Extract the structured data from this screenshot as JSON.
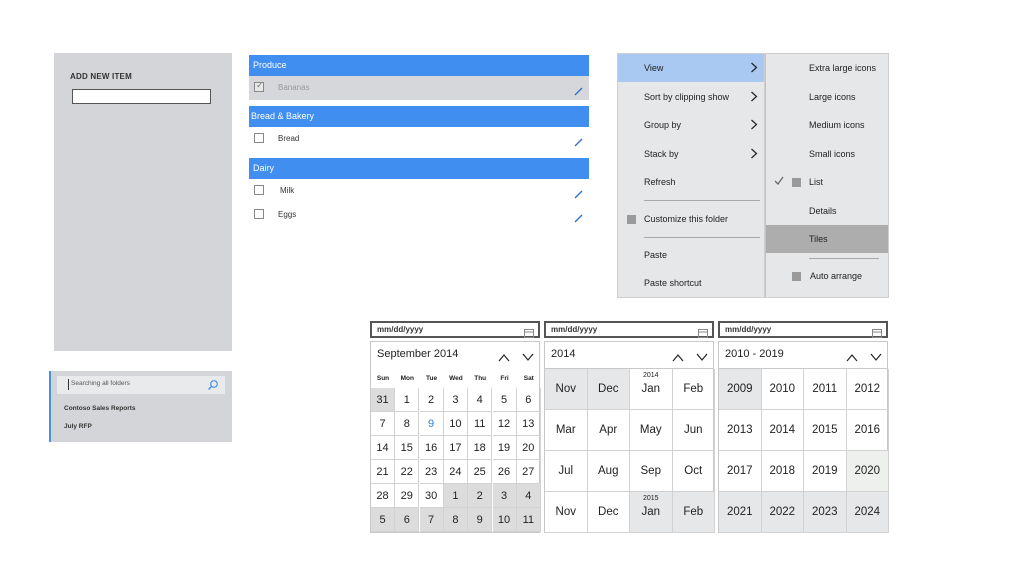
{
  "add_item": {
    "title": "ADD NEW ITEM",
    "input_value": ""
  },
  "search": {
    "placeholder": "Searching all folders",
    "results": [
      "Contoso Sales Reports",
      "July RFP"
    ]
  },
  "grocery": {
    "groups": [
      {
        "name": "Produce",
        "items": [
          {
            "label": "Bananas",
            "checked": true,
            "selected": true
          }
        ]
      },
      {
        "name": "Bread & Bakery",
        "items": [
          {
            "label": "Bread",
            "checked": false,
            "selected": false
          }
        ]
      },
      {
        "name": "Dairy",
        "items": [
          {
            "label": "Milk",
            "checked": false,
            "selected": false
          },
          {
            "label": "Eggs",
            "checked": false,
            "selected": false
          }
        ]
      }
    ]
  },
  "context_menu": {
    "main": [
      {
        "label": "View",
        "submenu": true,
        "highlighted": true
      },
      {
        "label": "Sort by clipping show",
        "submenu": true
      },
      {
        "label": "Group by",
        "submenu": true
      },
      {
        "label": "Stack by",
        "submenu": true
      },
      {
        "label": "Refresh",
        "submenu": false
      },
      {
        "label": "Customize this folder",
        "submenu": false
      },
      {
        "label": "Paste",
        "submenu": false
      },
      {
        "label": "Paste shortcut",
        "submenu": false
      }
    ],
    "sub": [
      {
        "label": "Extra large icons"
      },
      {
        "label": "Large icons"
      },
      {
        "label": "Medium icons"
      },
      {
        "label": "Small icons"
      },
      {
        "label": "List",
        "checked": true
      },
      {
        "label": "Details"
      },
      {
        "label": "Tiles",
        "selected": true
      },
      {
        "label": "Auto arrange"
      }
    ]
  },
  "date_placeholder": "mm/dd/yyyy",
  "calendar_month": {
    "header": "September 2014",
    "dow": [
      "Sun",
      "Mon",
      "Tue",
      "Wed",
      "Thu",
      "Fri",
      "Sat"
    ],
    "days": [
      [
        "31",
        1,
        2,
        3,
        4,
        5,
        6
      ],
      [
        7,
        8,
        9,
        10,
        11,
        12,
        13
      ],
      [
        14,
        15,
        16,
        17,
        18,
        19,
        20
      ],
      [
        21,
        22,
        23,
        24,
        25,
        26,
        27
      ],
      [
        28,
        29,
        30,
        1,
        2,
        3,
        4
      ],
      [
        5,
        6,
        7,
        8,
        9,
        10,
        11
      ]
    ],
    "today": 9
  },
  "calendar_year": {
    "header": "2014",
    "months": [
      {
        "v": "Nov",
        "out": true
      },
      {
        "v": "Dec",
        "out": true
      },
      {
        "v": "Jan",
        "sup": "2014"
      },
      {
        "v": "Feb"
      },
      {
        "v": "Mar"
      },
      {
        "v": "Apr"
      },
      {
        "v": "May"
      },
      {
        "v": "Jun"
      },
      {
        "v": "Jul"
      },
      {
        "v": "Aug"
      },
      {
        "v": "Sep"
      },
      {
        "v": "Oct"
      },
      {
        "v": "Nov"
      },
      {
        "v": "Dec"
      },
      {
        "v": "Jan",
        "sup": "2015",
        "out": true
      },
      {
        "v": "Feb",
        "out": true
      }
    ]
  },
  "calendar_decade": {
    "header": "2010 - 2019",
    "years": [
      {
        "v": "2009",
        "out": true
      },
      {
        "v": "2010"
      },
      {
        "v": "2011"
      },
      {
        "v": "2012"
      },
      {
        "v": "2013"
      },
      {
        "v": "2014"
      },
      {
        "v": "2015"
      },
      {
        "v": "2016"
      },
      {
        "v": "2017"
      },
      {
        "v": "2018"
      },
      {
        "v": "2019"
      },
      {
        "v": "2020",
        "alt": true
      },
      {
        "v": "2021",
        "out": true
      },
      {
        "v": "2022",
        "out": true
      },
      {
        "v": "2023",
        "out": true
      },
      {
        "v": "2024",
        "out": true
      }
    ]
  },
  "colors": {
    "accent": "#3f8ef0",
    "panel": "#d4d5d8",
    "menu_highlight": "#a9c8f2",
    "today": "#2c84d8"
  }
}
